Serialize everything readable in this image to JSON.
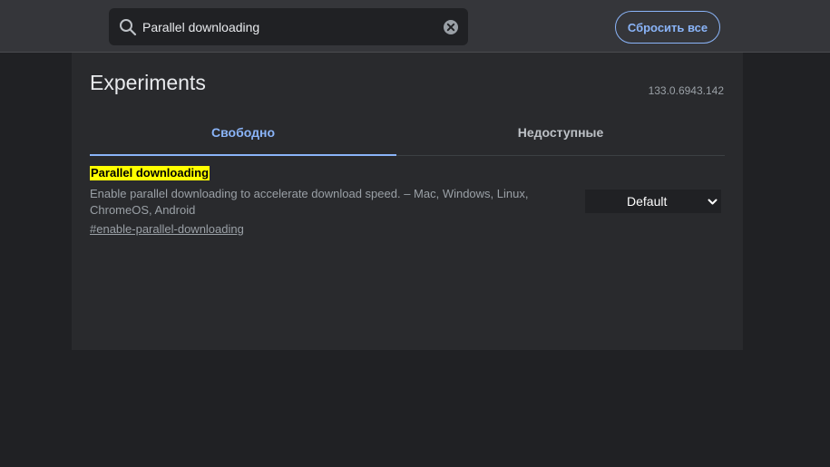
{
  "search": {
    "value": "Parallel downloading"
  },
  "header": {
    "reset_label": "Сбросить все"
  },
  "page": {
    "title": "Experiments",
    "version": "133.0.6943.142"
  },
  "tabs": [
    {
      "label": "Свободно",
      "active": true
    },
    {
      "label": "Недоступные",
      "active": false
    }
  ],
  "experiments": [
    {
      "name": "Parallel downloading",
      "description": "Enable parallel downloading to accelerate download speed. – Mac, Windows, Linux, ChromeOS, Android",
      "link": "#enable-parallel-downloading",
      "selected": "Default"
    }
  ],
  "colors": {
    "background": "#202124",
    "header": "#35363a",
    "panel": "#292a2d",
    "accent": "#8ab4f8",
    "highlight": "#ffff00"
  }
}
